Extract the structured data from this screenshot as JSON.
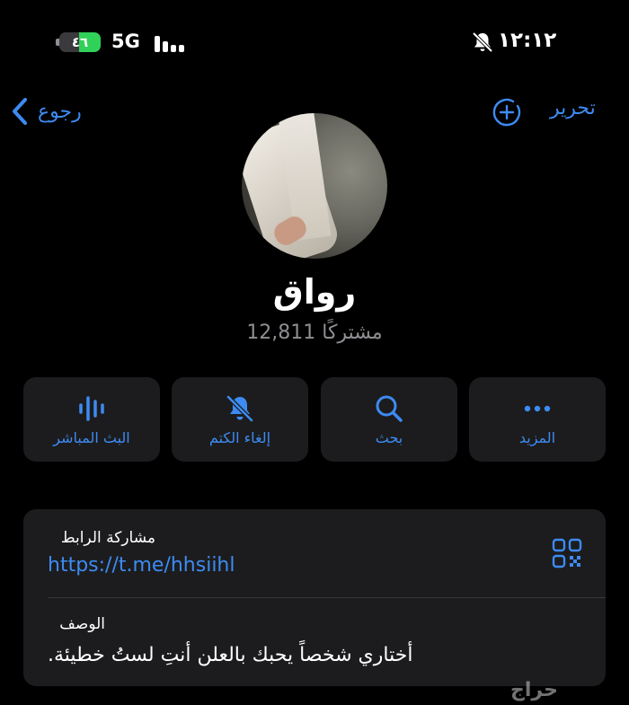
{
  "status_bar": {
    "battery_level": "٤٦",
    "network": "5G",
    "time": "١٢:١٢",
    "silent_icon": "bell-slash-icon",
    "signal_icon": "signal-bars-icon"
  },
  "nav": {
    "back_label": "رجوع",
    "edit_label": "تحرير",
    "add_icon": "add-circle-icon"
  },
  "profile": {
    "name": "رواق",
    "subscribers": "12,811 مشتركًا"
  },
  "actions": [
    {
      "label": "البث المباشر",
      "icon": "voice-chat-icon"
    },
    {
      "label": "إلغاء الكتم",
      "icon": "unmute-bell-icon"
    },
    {
      "label": "بحث",
      "icon": "search-icon"
    },
    {
      "label": "المزيد",
      "icon": "more-icon"
    }
  ],
  "info": {
    "link_caption": "مشاركة الرابط",
    "link_value": "https://t.me/hhsiihl",
    "description_caption": "الوصف",
    "description_value": "أختاري شخصاً يحبك بالعلن أنتِ لستُ خطيئة."
  },
  "watermark": "حراج",
  "colors": {
    "accent": "#3d8bf2",
    "background": "#000000",
    "card": "#1c1c1e",
    "secondary_text": "#8e8e93",
    "battery": "#30d158"
  }
}
